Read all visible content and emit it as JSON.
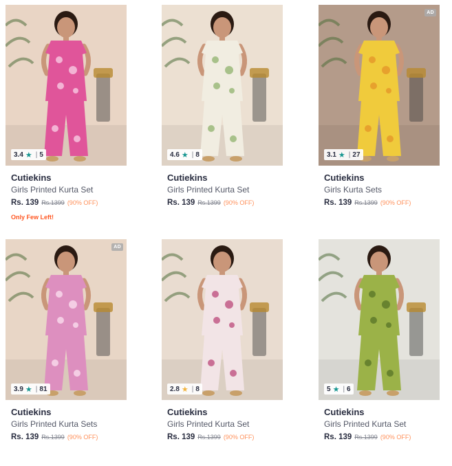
{
  "products": [
    {
      "brand": "Cutiekins",
      "name": "Girls Printed Kurta Set",
      "price": "Rs. 139",
      "mrp": "Rs.1399",
      "discount": "(90% OFF)",
      "rating": "3.4",
      "rating_count": "5",
      "star_color": "#14958f",
      "ad_label": "",
      "stock_note": "Only Few Left!",
      "bg": "#e9d5c5",
      "outfit": "#e0559a",
      "print": "#f6c4de",
      "image_icon": "girl-in-pink-kurta-set-image"
    },
    {
      "brand": "Cutiekins",
      "name": "Girls Printed Kurta Set",
      "price": "Rs. 139",
      "mrp": "Rs.1399",
      "discount": "(90% OFF)",
      "rating": "4.6",
      "rating_count": "8",
      "star_color": "#14958f",
      "ad_label": "",
      "stock_note": "",
      "bg": "#ece0d2",
      "outfit": "#f1ede1",
      "print": "#9bb87a",
      "image_icon": "girl-in-white-floral-kurta-set-image"
    },
    {
      "brand": "Cutiekins",
      "name": "Girls Kurta Sets",
      "price": "Rs. 139",
      "mrp": "Rs.1399",
      "discount": "(90% OFF)",
      "rating": "3.1",
      "rating_count": "27",
      "star_color": "#14958f",
      "ad_label": "AD",
      "stock_note": "",
      "bg": "#b49b8a",
      "outfit": "#f0cb3c",
      "print": "#e59a2a",
      "image_icon": "girl-in-yellow-kurta-set-image"
    },
    {
      "brand": "Cutiekins",
      "name": "Girls Printed Kurta Sets",
      "price": "Rs. 139",
      "mrp": "Rs.1399",
      "discount": "(90% OFF)",
      "rating": "3.9",
      "rating_count": "81",
      "star_color": "#14958f",
      "ad_label": "AD",
      "stock_note": "",
      "bg": "#e8d6c6",
      "outfit": "#dd8fbf",
      "print": "#f8d8ea",
      "image_icon": "girl-in-pink-printed-kurta-set-image"
    },
    {
      "brand": "Cutiekins",
      "name": "Girls Printed Kurta Set",
      "price": "Rs. 139",
      "mrp": "Rs.1399",
      "discount": "(90% OFF)",
      "rating": "2.8",
      "rating_count": "8",
      "star_color": "#f2b33d",
      "ad_label": "",
      "stock_note": "",
      "bg": "#e9dcd0",
      "outfit": "#f2e4e6",
      "print": "#c25a86",
      "image_icon": "girl-in-floral-kurta-set-image"
    },
    {
      "brand": "Cutiekins",
      "name": "Girls Printed Kurta Set",
      "price": "Rs. 139",
      "mrp": "Rs.1399",
      "discount": "(90% OFF)",
      "rating": "5",
      "rating_count": "6",
      "star_color": "#14958f",
      "ad_label": "",
      "stock_note": "",
      "bg": "#e4e3dd",
      "outfit": "#9bb248",
      "print": "#5f7a2b",
      "image_icon": "girl-in-green-kurta-set-image"
    }
  ]
}
